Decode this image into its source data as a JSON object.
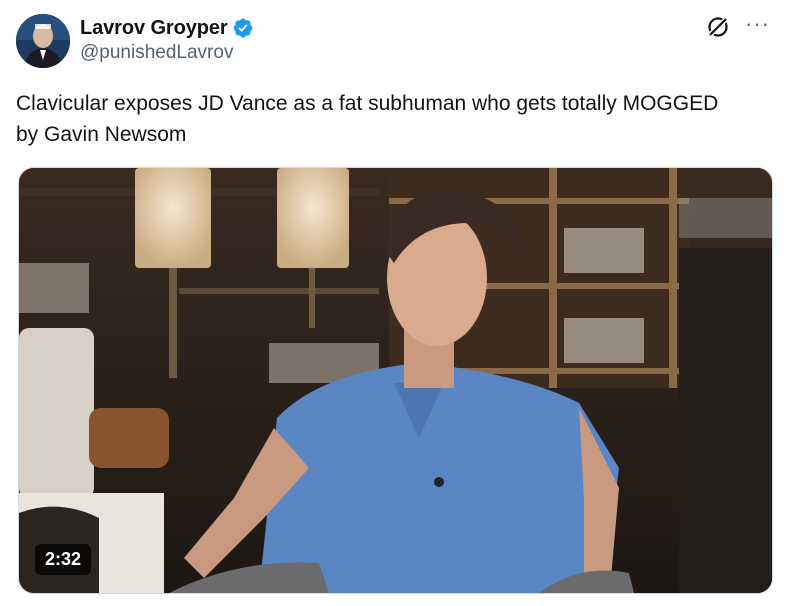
{
  "author": {
    "display_name": "Lavrov Groyper",
    "handle": "@punishedLavrov",
    "verified": true,
    "verified_color": "#1d9bf0"
  },
  "icons": {
    "grok": "grok-icon",
    "more": "more-icon",
    "verified": "verified-badge-icon"
  },
  "tweet": {
    "text": "Clavicular exposes JD Vance as a fat subhuman who gets totally MOGGED by Gavin Newsom"
  },
  "video": {
    "duration": "2:32",
    "description_colors": {
      "shirt": "#5b86c4",
      "background": "#2a221c"
    }
  }
}
